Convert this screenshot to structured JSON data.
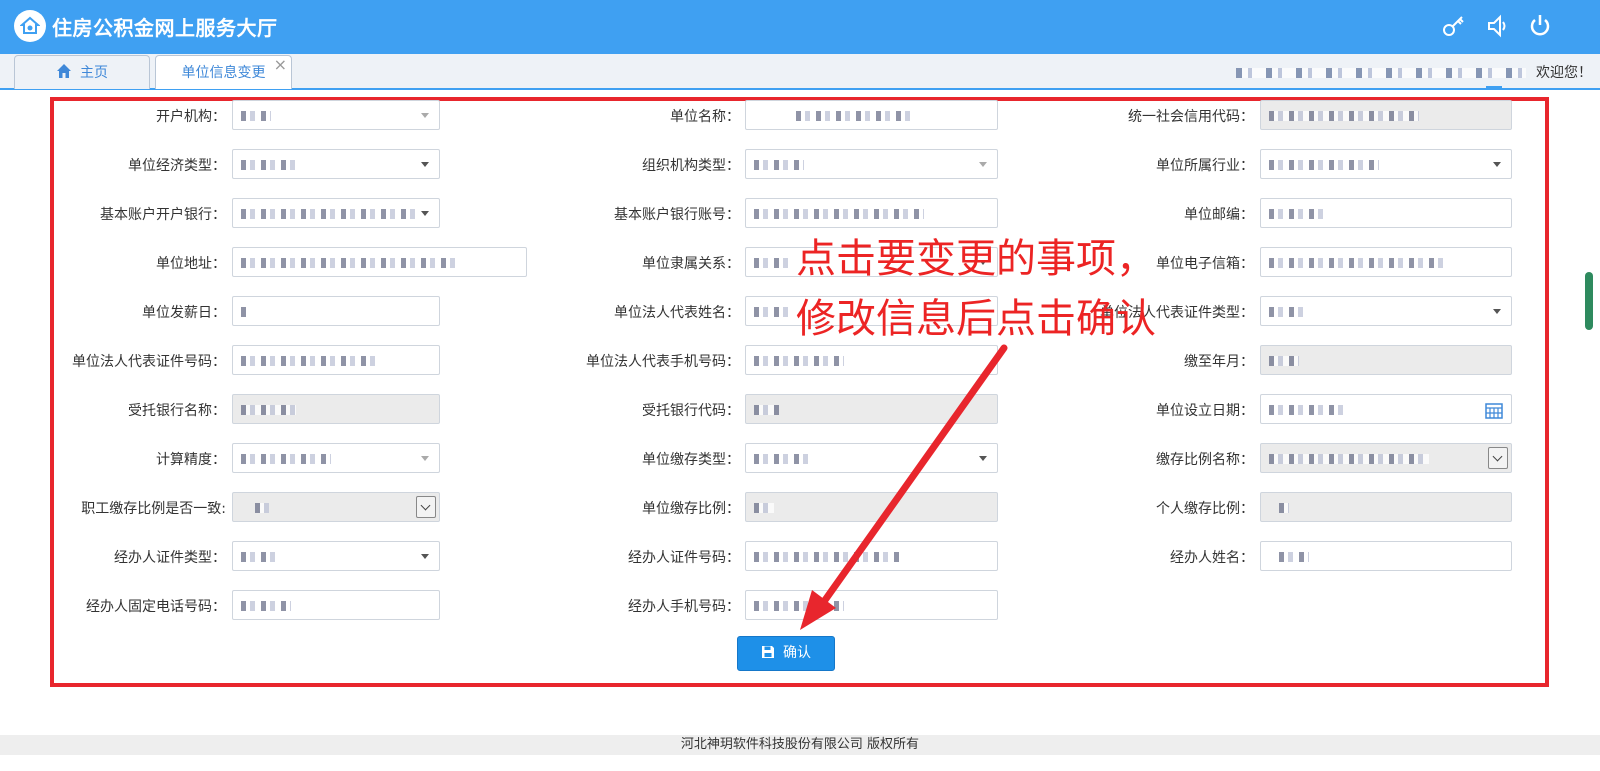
{
  "header": {
    "title": "住房公积金网上服务大厅",
    "colors": {
      "brand": "#3fa0f2",
      "annotation": "#e8262d",
      "button": "#1e90e8"
    }
  },
  "tabs": [
    {
      "label": "主页"
    },
    {
      "label": "单位信息变更"
    }
  ],
  "welcome": {
    "text": "欢迎您！"
  },
  "form": {
    "fields": [
      {
        "label": "开户机构："
      },
      {
        "label": "单位名称："
      },
      {
        "label": "统一社会信用代码："
      },
      {
        "label": "单位经济类型："
      },
      {
        "label": "组织机构类型："
      },
      {
        "label": "单位所属行业："
      },
      {
        "label": "基本账户开户银行："
      },
      {
        "label": "基本账户银行账号："
      },
      {
        "label": "单位邮编："
      },
      {
        "label": "单位地址："
      },
      {
        "label": "单位隶属关系："
      },
      {
        "label": "单位电子信箱："
      },
      {
        "label": "单位发薪日："
      },
      {
        "label": "单位法人代表姓名："
      },
      {
        "label": "单位法人代表证件类型："
      },
      {
        "label": "单位法人代表证件号码："
      },
      {
        "label": "单位法人代表手机号码："
      },
      {
        "label": "缴至年月："
      },
      {
        "label": "受托银行名称："
      },
      {
        "label": "受托银行代码："
      },
      {
        "label": "单位设立日期："
      },
      {
        "label": "计算精度："
      },
      {
        "label": "单位缴存类型："
      },
      {
        "label": "缴存比例名称："
      },
      {
        "label": "职工缴存比例是否一致:"
      },
      {
        "label": "单位缴存比例："
      },
      {
        "label": "个人缴存比例："
      },
      {
        "label": "经办人证件类型："
      },
      {
        "label": "经办人证件号码："
      },
      {
        "label": "经办人姓名："
      },
      {
        "label": "经办人固定电话号码："
      },
      {
        "label": "经办人手机号码："
      }
    ],
    "confirm_label": "确认"
  },
  "annotation": {
    "line1": "点击要变更的事项，",
    "line2": "修改信息后点击确认"
  },
  "footer": {
    "text": "河北神玥软件科技股份有限公司 版权所有"
  }
}
